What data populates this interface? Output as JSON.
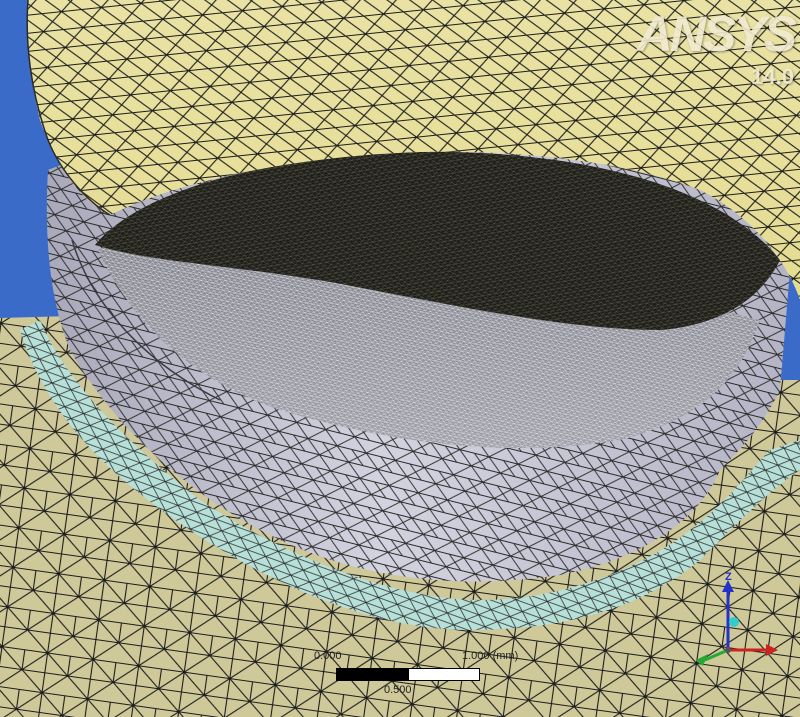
{
  "viewer": {
    "logo": "ANSYS",
    "version": "14.0"
  },
  "scale_bar": {
    "start_label": "0.000",
    "end_label": "1.000 (mm)",
    "mid_label": "0.500"
  },
  "triad": {
    "z_label": "Z"
  },
  "colors": {
    "background": "#3a6bc8",
    "yellow_mesh": "#cfc899",
    "cap_mesh": "#ece39b",
    "grey_wall": "#c7c7d7",
    "cyan_band": "#b6e0d8",
    "dark_surface": "#1b1b18",
    "fine_band": "#8c8c96",
    "mesh_line": "#1a1a1a"
  }
}
